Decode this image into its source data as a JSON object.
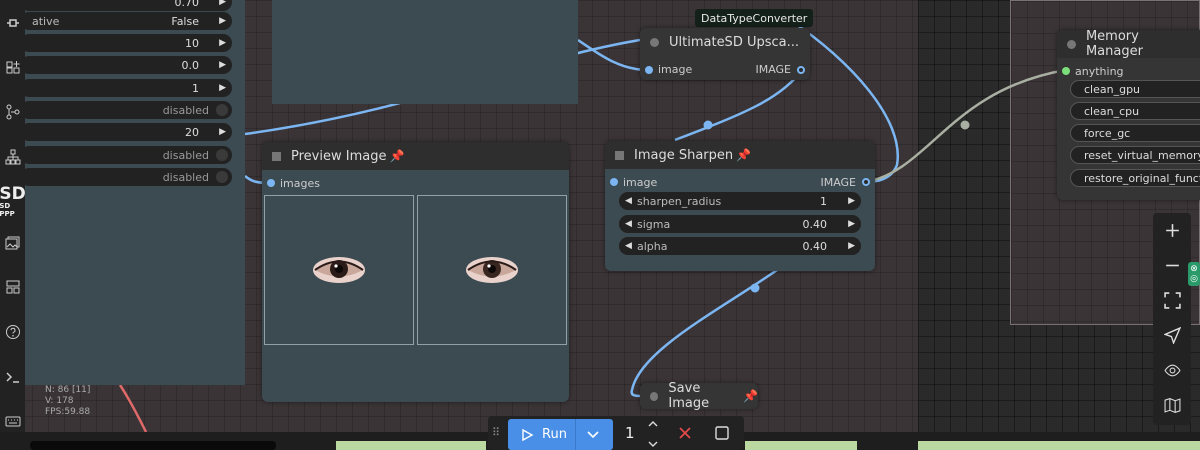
{
  "left_node": {
    "rows": [
      {
        "label": "",
        "value": "0.70"
      },
      {
        "label": "ative",
        "value": "False"
      },
      {
        "label": "",
        "value": "10"
      },
      {
        "label": "",
        "value": "0.0"
      },
      {
        "label": "",
        "value": "1"
      },
      {
        "label": "",
        "value": "disabled"
      },
      {
        "label": "",
        "value": "20"
      },
      {
        "label": "",
        "value": "disabled"
      },
      {
        "label": "",
        "value": "disabled"
      }
    ]
  },
  "sidebar": {
    "sdppp_logo": "SD",
    "sdppp_text": "SD PPP"
  },
  "stats": {
    "nodes": "N: 86 [11]",
    "vertices": "V: 178",
    "fps": "FPS:59.88"
  },
  "tooltip": "DataTypeConverter",
  "upscale_node": {
    "title": "UltimateSD Upsca...",
    "input": "image",
    "output": "IMAGE"
  },
  "preview_node": {
    "title": "Preview Image",
    "input": "images"
  },
  "sharpen_node": {
    "title": "Image Sharpen",
    "input": "image",
    "output": "IMAGE",
    "widgets": [
      {
        "label": "sharpen_radius",
        "value": "1"
      },
      {
        "label": "sigma",
        "value": "0.40"
      },
      {
        "label": "alpha",
        "value": "0.40"
      }
    ]
  },
  "memory_node": {
    "title": "Memory Manager",
    "input": "anything",
    "widgets": [
      "clean_gpu",
      "clean_cpu",
      "force_gc",
      "reset_virtual_memory",
      "restore_original_functi"
    ]
  },
  "save_node": {
    "title": "Save Image"
  },
  "runbar": {
    "run_label": "Run",
    "batch_count": "1"
  },
  "colors": {
    "accent": "#4a8fe7",
    "link_blue": "#7cb6f2",
    "link_gray": "#a9b0a2",
    "pin": "#e8357a"
  }
}
